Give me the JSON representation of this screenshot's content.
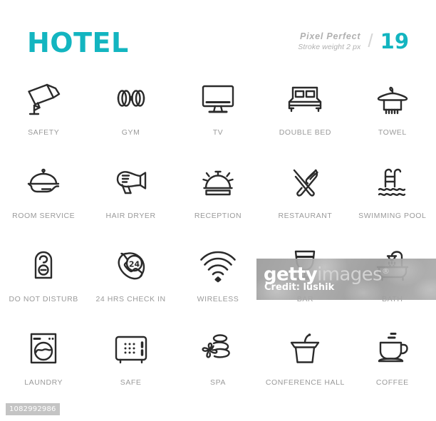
{
  "header": {
    "title": "HOTEL",
    "pixel_perfect": "Pixel  Perfect",
    "stroke_weight": "Stroke weight 2 px",
    "separator": "/",
    "icon_count": "19",
    "accent_color": "#13B5C0",
    "label_color": "#9a9a9a",
    "icon_color": "#2b2b2b"
  },
  "icons": [
    {
      "label": "SAFETY",
      "icon": "security-camera-icon"
    },
    {
      "label": "GYM",
      "icon": "dumbbell-icon"
    },
    {
      "label": "TV",
      "icon": "television-icon"
    },
    {
      "label": "DOUBLE BED",
      "icon": "double-bed-icon"
    },
    {
      "label": "TOWEL",
      "icon": "towel-hanger-icon"
    },
    {
      "label": "ROOM SERVICE",
      "icon": "cloche-tray-icon"
    },
    {
      "label": "HAIR DRYER",
      "icon": "hair-dryer-icon"
    },
    {
      "label": "RECEPTION",
      "icon": "reception-bell-icon"
    },
    {
      "label": "RESTAURANT",
      "icon": "fork-knife-icon"
    },
    {
      "label": "SWIMMING POOL",
      "icon": "swimming-pool-icon"
    },
    {
      "label": "DO NOT DISTURB",
      "icon": "door-hanger-icon"
    },
    {
      "label": "24 HRS CHECK IN",
      "icon": "phone-24hrs-icon"
    },
    {
      "label": "WIRELESS",
      "icon": "wifi-icon"
    },
    {
      "label": "BAR",
      "icon": "wine-glass-icon"
    },
    {
      "label": "BATH",
      "icon": "bathtub-shower-icon"
    },
    {
      "label": "LAUNDRY",
      "icon": "washing-machine-icon"
    },
    {
      "label": "SAFE",
      "icon": "safe-box-icon"
    },
    {
      "label": "SPA",
      "icon": "spa-stones-flower-icon"
    },
    {
      "label": "CONFERENCE HALL",
      "icon": "lectern-podium-icon"
    },
    {
      "label": "COFFEE",
      "icon": "coffee-cup-icon"
    }
  ],
  "watermark": {
    "logo_bold": "getty",
    "logo_light": "images",
    "trademark": "®",
    "credit": "Credit: lushik",
    "asset_id": "1082992986"
  }
}
